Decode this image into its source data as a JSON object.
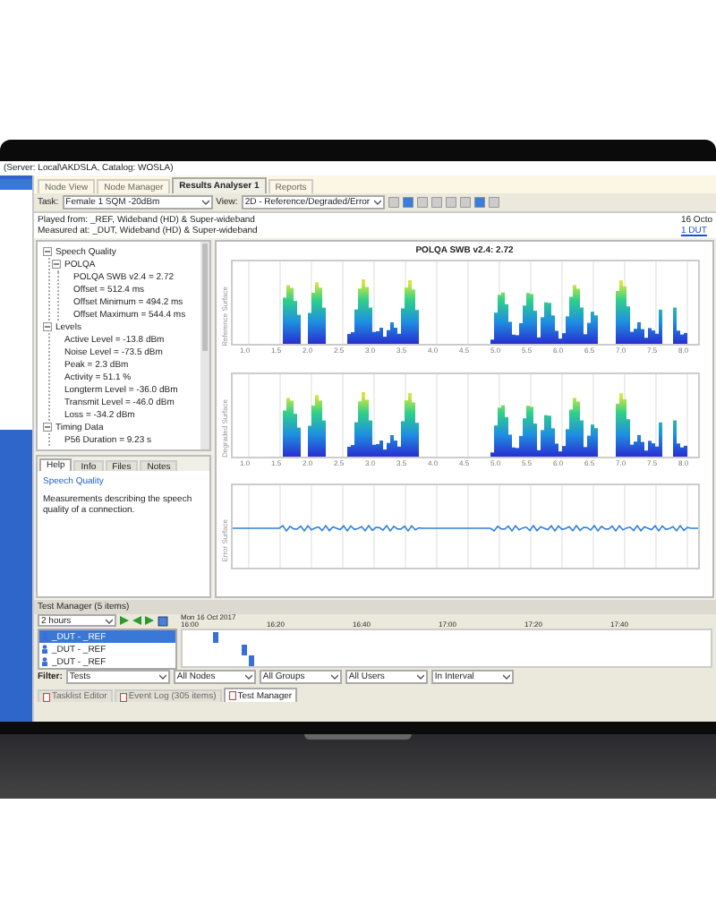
{
  "window": {
    "title": "(Server: Local\\AKDSLA, Catalog: WOSLA)"
  },
  "tabs": [
    {
      "label": "Node View",
      "selected": false
    },
    {
      "label": "Node Manager",
      "selected": false
    },
    {
      "label": "Results Analyser 1",
      "selected": true
    },
    {
      "label": "Reports",
      "selected": false
    }
  ],
  "toolbar": {
    "task_label": "Task:",
    "task_value": "Female 1 SQM -20dBm",
    "view_label": "View:",
    "view_value": "2D - Reference/Degraded/Error"
  },
  "info": {
    "played_from": "Played from: _REF, Wideband (HD) & Super-wideband",
    "measured_at": "Measured at: _DUT, Wideband (HD) & Super-wideband",
    "date": "16 Octo",
    "link": "1 DUT"
  },
  "tree": [
    {
      "label": "Speech Quality",
      "expanded": true,
      "children": [
        {
          "label": "POLQA",
          "expanded": true,
          "children": [
            {
              "label": "POLQA SWB v2.4 = 2.72"
            },
            {
              "label": "Offset = 512.4 ms"
            },
            {
              "label": "Offset Minimum = 494.2 ms"
            },
            {
              "label": "Offset Maximum = 544.4 ms"
            }
          ]
        }
      ]
    },
    {
      "label": "Levels",
      "expanded": true,
      "children": [
        {
          "label": "Active Level = -13.8 dBm"
        },
        {
          "label": "Noise Level = -73.5 dBm"
        },
        {
          "label": "Peak = 2.3 dBm"
        },
        {
          "label": "Activity = 51.1 %"
        },
        {
          "label": "Longterm Level = -36.0 dBm"
        },
        {
          "label": "Transmit Level = -46.0 dBm"
        },
        {
          "label": "Loss = -34.2 dBm"
        }
      ]
    },
    {
      "label": "Timing Data",
      "expanded": true,
      "children": [
        {
          "label": "P56 Duration = 9.23 s"
        }
      ]
    }
  ],
  "help": {
    "tabs": [
      {
        "label": "Help",
        "selected": true
      },
      {
        "label": "Info",
        "selected": false
      },
      {
        "label": "Files",
        "selected": false
      },
      {
        "label": "Notes",
        "selected": false
      }
    ],
    "topic": "Speech Quality",
    "text": "Measurements describing the speech quality of a connection."
  },
  "charts": {
    "title": "POLQA SWB v2.4: 2.72",
    "panels": [
      {
        "kind": "spectrogram",
        "ylabel": "Reference Surface",
        "xticks": [
          "1.0",
          "1.5",
          "2.0",
          "2.5",
          "3.0",
          "3.5",
          "4.0",
          "4.5",
          "5.0",
          "5.5",
          "6.0",
          "6.5",
          "7.0",
          "7.5",
          "8.0"
        ]
      },
      {
        "kind": "spectrogram",
        "ylabel": "Degraded Surface",
        "xticks": [
          "1.0",
          "1.5",
          "2.0",
          "2.5",
          "3.0",
          "3.5",
          "4.0",
          "4.5",
          "5.0",
          "5.5",
          "6.0",
          "6.5",
          "7.0",
          "7.5",
          "8.0"
        ]
      },
      {
        "kind": "error",
        "ylabel": "Error Surface"
      }
    ]
  },
  "test_manager": {
    "title": "Test Manager (5 items)",
    "range": "2 hours",
    "date": "Mon 16 Oct 2017",
    "times": [
      "16:00",
      "16:20",
      "16:40",
      "17:00",
      "17:20",
      "17:40"
    ],
    "rows": [
      {
        "label": "_DUT - _REF",
        "selected": true
      },
      {
        "label": "_DUT - _REF",
        "selected": false
      },
      {
        "label": "_DUT - _REF",
        "selected": false
      }
    ],
    "filter_label": "Filter:",
    "filters": [
      "Tests",
      "All Nodes",
      "All Groups",
      "All Users",
      "In Interval"
    ],
    "bottom_tabs": [
      {
        "label": "Tasklist Editor",
        "selected": false
      },
      {
        "label": "Event Log (305 items)",
        "selected": false
      },
      {
        "label": "Test Manager",
        "selected": true
      }
    ]
  }
}
